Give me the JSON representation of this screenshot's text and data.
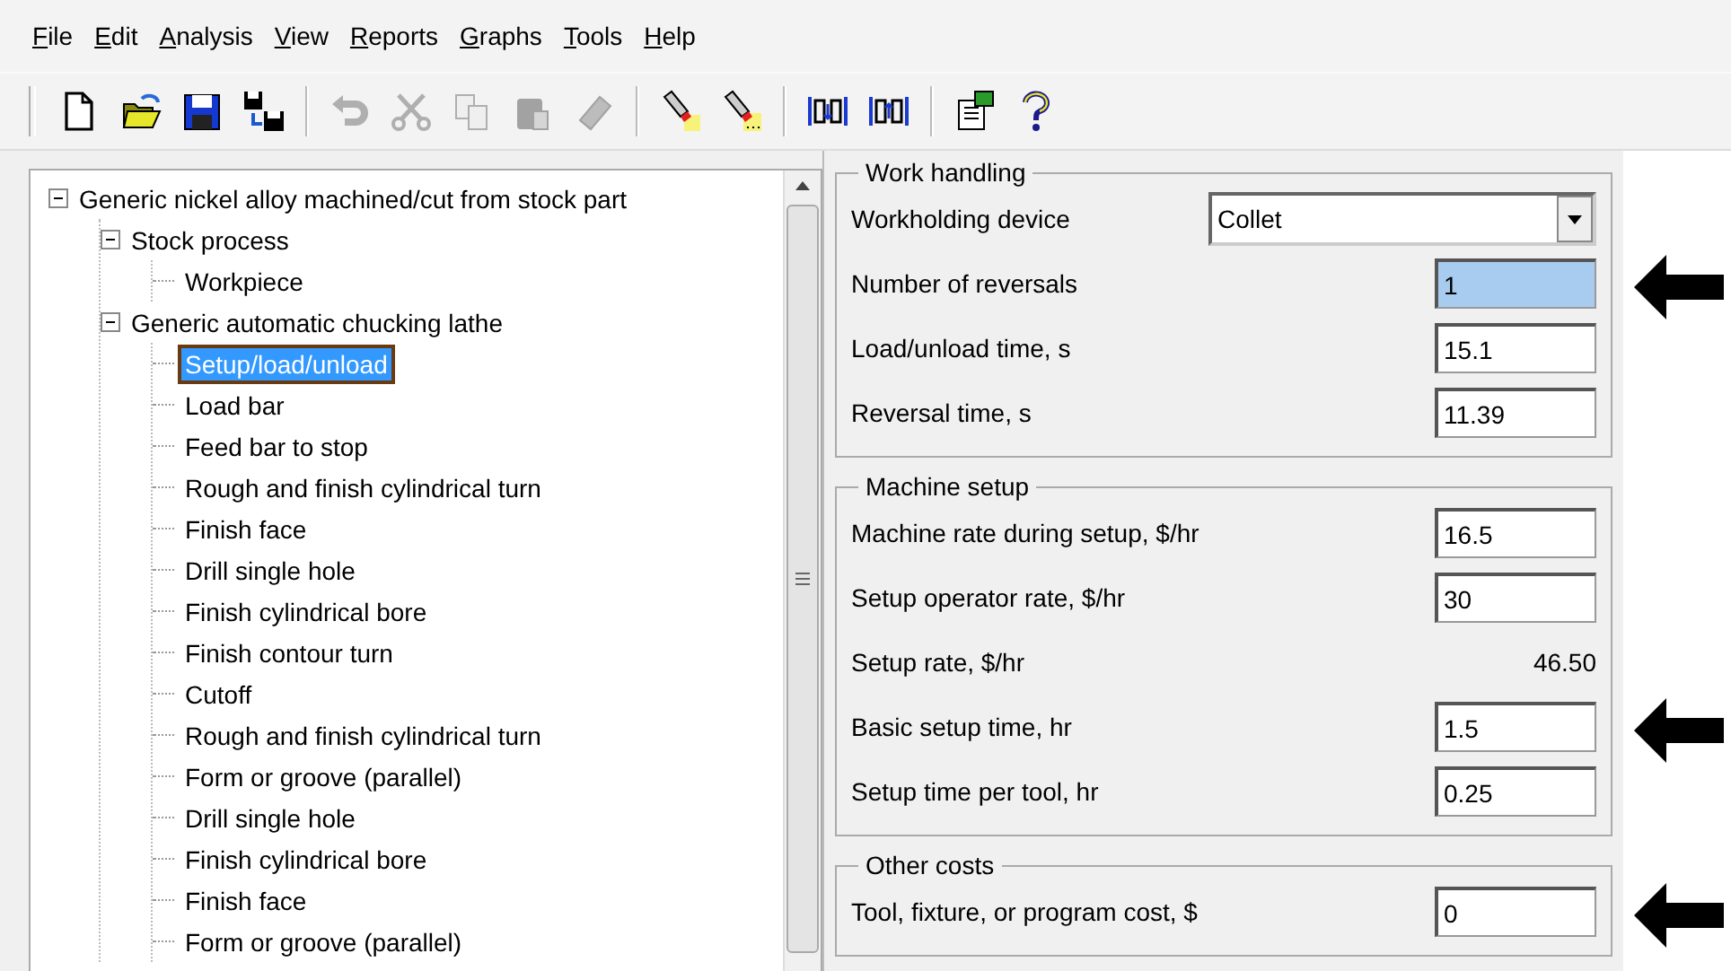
{
  "menu": [
    "File",
    "Edit",
    "Analysis",
    "View",
    "Reports",
    "Graphs",
    "Tools",
    "Help"
  ],
  "toolbar": [
    {
      "kind": "new",
      "disabled": false
    },
    {
      "kind": "open",
      "disabled": false
    },
    {
      "kind": "save",
      "disabled": false
    },
    {
      "kind": "saveas",
      "disabled": false
    },
    {
      "kind": "sep"
    },
    {
      "kind": "undo",
      "disabled": true
    },
    {
      "kind": "cut",
      "disabled": true
    },
    {
      "kind": "copy",
      "disabled": true
    },
    {
      "kind": "paste",
      "disabled": true
    },
    {
      "kind": "eraser",
      "disabled": true
    },
    {
      "kind": "sep"
    },
    {
      "kind": "highlight",
      "disabled": false
    },
    {
      "kind": "highlight-more",
      "disabled": false
    },
    {
      "kind": "sep"
    },
    {
      "kind": "collapse",
      "disabled": false
    },
    {
      "kind": "expand",
      "disabled": false
    },
    {
      "kind": "sep"
    },
    {
      "kind": "report",
      "disabled": false
    },
    {
      "kind": "help",
      "disabled": false
    }
  ],
  "tree": [
    {
      "label": "Generic nickel alloy machined/cut from stock part",
      "selected": false,
      "expanded": true,
      "children": [
        {
          "label": "Stock process",
          "selected": false,
          "expanded": true,
          "children": [
            {
              "label": "Workpiece",
              "selected": false
            }
          ]
        },
        {
          "label": "Generic automatic chucking lathe",
          "selected": false,
          "expanded": true,
          "children": [
            {
              "label": "Setup/load/unload",
              "selected": true
            },
            {
              "label": "Load bar",
              "selected": false
            },
            {
              "label": "Feed bar to stop",
              "selected": false
            },
            {
              "label": "Rough and finish cylindrical turn",
              "selected": false
            },
            {
              "label": "Finish face",
              "selected": false
            },
            {
              "label": "Drill single hole",
              "selected": false
            },
            {
              "label": "Finish cylindrical bore",
              "selected": false
            },
            {
              "label": "Finish contour turn",
              "selected": false
            },
            {
              "label": "Cutoff",
              "selected": false
            },
            {
              "label": "Rough and finish cylindrical turn",
              "selected": false
            },
            {
              "label": "Form or groove (parallel)",
              "selected": false
            },
            {
              "label": "Drill single hole",
              "selected": false
            },
            {
              "label": "Finish cylindrical bore",
              "selected": false
            },
            {
              "label": "Finish face",
              "selected": false
            },
            {
              "label": "Form or groove (parallel)",
              "selected": false
            }
          ]
        }
      ]
    }
  ],
  "groups": [
    {
      "title": "Work handling",
      "fields": [
        {
          "kind": "dropdown",
          "label": "Workholding device",
          "value": "Collet",
          "selected": false,
          "arrow": false
        },
        {
          "kind": "input",
          "label": "Number of  reversals",
          "value": "1",
          "selected": true,
          "arrow": true
        },
        {
          "kind": "input",
          "label": "Load/unload time, s",
          "value": "15.1",
          "selected": false,
          "arrow": false
        },
        {
          "kind": "input",
          "label": "Reversal time, s",
          "value": "11.39",
          "selected": false,
          "arrow": false
        }
      ]
    },
    {
      "title": "Machine setup",
      "fields": [
        {
          "kind": "input",
          "label": "Machine rate during setup, $/hr",
          "value": "16.5",
          "selected": false,
          "arrow": false
        },
        {
          "kind": "input",
          "label": "Setup operator rate, $/hr",
          "value": "30",
          "selected": false,
          "arrow": false
        },
        {
          "kind": "readout",
          "label": "Setup rate, $/hr",
          "value": "46.50",
          "selected": false,
          "arrow": false
        },
        {
          "kind": "input",
          "label": "Basic setup time, hr",
          "value": "1.5",
          "selected": false,
          "arrow": true
        },
        {
          "kind": "input",
          "label": "Setup time per tool, hr",
          "value": "0.25",
          "selected": false,
          "arrow": false
        }
      ]
    },
    {
      "title": "Other costs",
      "fields": [
        {
          "kind": "input",
          "label": "Tool, fixture, or program cost, $",
          "value": "0",
          "selected": false,
          "arrow": true
        }
      ]
    }
  ]
}
